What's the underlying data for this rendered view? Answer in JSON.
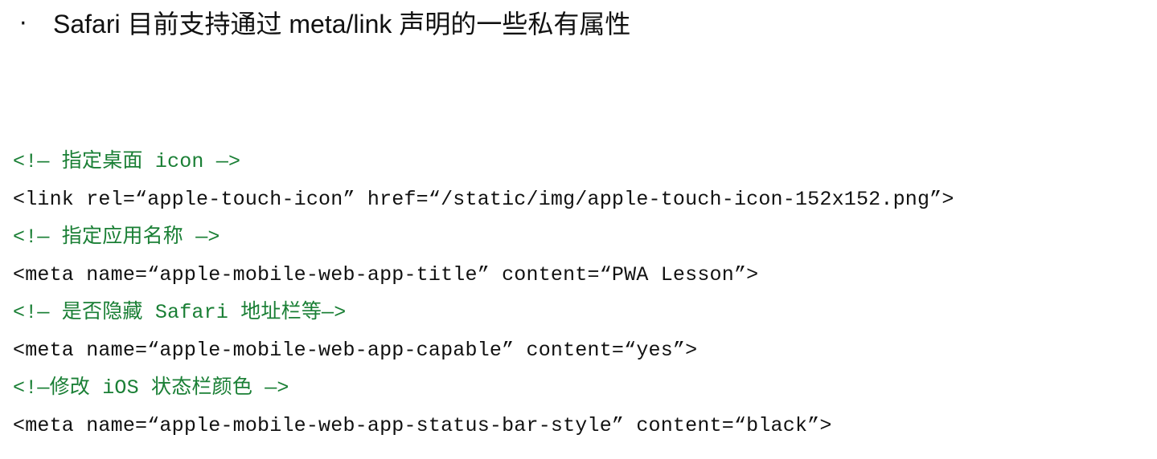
{
  "slide": {
    "bullet": "·",
    "heading": "Safari 目前支持通过 meta/link 声明的一些私有属性"
  },
  "code": {
    "lines": [
      {
        "text": "<!— 指定桌面 icon —>",
        "kind": "comment"
      },
      {
        "text": "<link rel=“apple-touch-icon” href=“/static/img/apple-touch-icon-152x152.png”>",
        "kind": "markup"
      },
      {
        "text": "<!— 指定应用名称 —>",
        "kind": "comment"
      },
      {
        "text": "<meta name=“apple-mobile-web-app-title” content=“PWA Lesson”>",
        "kind": "markup"
      },
      {
        "text": "<!— 是否隐藏 Safari 地址栏等—>",
        "kind": "comment"
      },
      {
        "text": "<meta name=“apple-mobile-web-app-capable” content=“yes”>",
        "kind": "markup"
      },
      {
        "text": "<!—修改 iOS 状态栏颜色 —>",
        "kind": "comment"
      },
      {
        "text": "<meta name=“apple-mobile-web-app-status-bar-style” content=“black”>",
        "kind": "markup"
      }
    ]
  },
  "colors": {
    "comment": "#1a7f35",
    "text": "#111111",
    "background": "#ffffff"
  }
}
